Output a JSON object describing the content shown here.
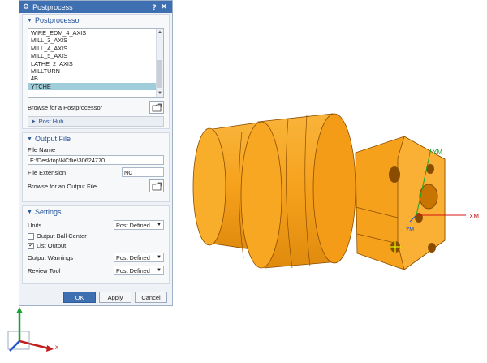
{
  "dialog": {
    "title": "Postprocess",
    "help_glyph": "?",
    "close_glyph": "✕"
  },
  "postprocessor": {
    "header": "Postprocessor",
    "items": [
      "WIRE_EDM_4_AXIS",
      "MILL_3_AXIS",
      "MILL_4_AXIS",
      "MILL_5_AXIS",
      "LATHE_2_AXIS",
      "MILLTURN",
      "4B",
      "YTCHE"
    ],
    "selected_index": 7,
    "browse_label": "Browse for a Postprocessor",
    "post_hub_label": "Post Hub"
  },
  "output_file": {
    "header": "Output File",
    "file_name_label": "File Name",
    "file_name_value": "E:\\Desktop\\NCflie\\30624770",
    "file_extension_label": "File Extension",
    "file_extension_value": "NC",
    "browse_label": "Browse for an Output File"
  },
  "settings": {
    "header": "Settings",
    "units_label": "Units",
    "units_value": "Post Defined",
    "output_ball_center_label": "Output Ball Center",
    "output_ball_center_checked": false,
    "list_output_label": "List Output",
    "list_output_checked": true,
    "output_warnings_label": "Output Warnings",
    "output_warnings_value": "Post Defined",
    "review_tool_label": "Review Tool",
    "review_tool_value": "Post Defined"
  },
  "buttons": {
    "ok": "OK",
    "apply": "Apply",
    "cancel": "Cancel"
  },
  "viewport": {
    "part_color": "#f6a11c",
    "axis_xm": "XM",
    "axis_ym": "YM",
    "axis_zm": "ZM",
    "triad_x": "x"
  }
}
